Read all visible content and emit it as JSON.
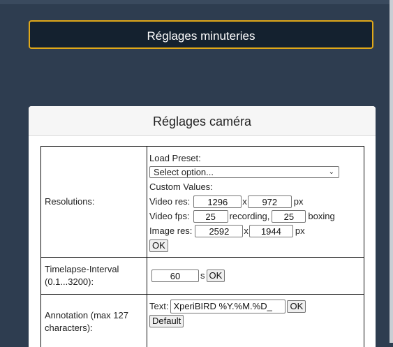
{
  "timers_button": {
    "label": "Réglages minuteries"
  },
  "camera_panel": {
    "title": "Réglages caméra",
    "resolutions": {
      "label": "Resolutions:",
      "load_preset_label": "Load Preset:",
      "preset_select": "Select option...",
      "custom_values_label": "Custom Values:",
      "video_res_label": "Video res:",
      "video_res_width": "1296",
      "video_res_x": "x",
      "video_res_height": "972",
      "video_res_unit": "px",
      "video_fps_label": "Video fps:",
      "video_fps_recording": "25",
      "recording_label": "recording,",
      "video_fps_boxing": "25",
      "boxing_label": "boxing",
      "image_res_label": "Image res:",
      "image_res_width": "2592",
      "image_res_x": "x",
      "image_res_height": "1944",
      "image_res_unit": "px",
      "ok_label": "OK"
    },
    "timelapse": {
      "label": "Timelapse-Interval (0.1...3200):",
      "value": "60",
      "unit": "s",
      "ok_label": "OK"
    },
    "annotation": {
      "label": "Annotation (max 127 characters):",
      "text_label": "Text:",
      "text_value": "XperiBIRD %Y.%M.%D_",
      "ok_label": "OK",
      "default_label": "Default"
    }
  }
}
